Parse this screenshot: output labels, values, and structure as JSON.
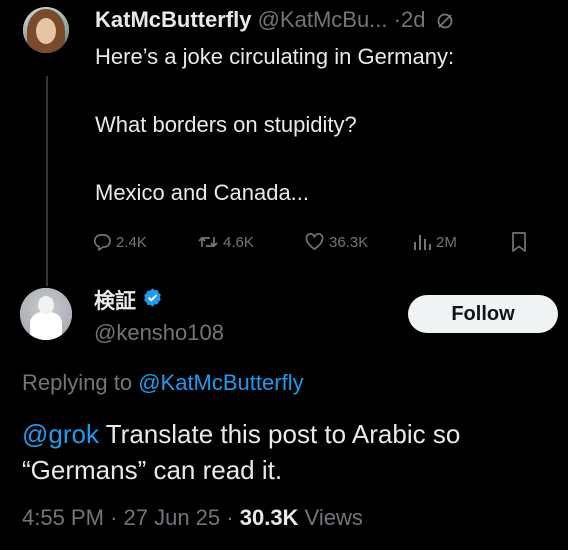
{
  "parent_tweet": {
    "author_name": "KatMcButterfly",
    "author_handle": "@KatMcBu...",
    "separator": "·",
    "time": "2d",
    "text": "Here’s a joke circulating in Germany:\n\nWhat borders on stupidity?\n\nMexico and Canada...",
    "replies": "2.4K",
    "reposts": "4.6K",
    "likes": "36.3K",
    "views": "2M"
  },
  "reply_tweet": {
    "author_name": "検証",
    "author_handle": "@kensho108",
    "follow_label": "Follow",
    "replying_prefix": "Replying to",
    "replying_to": "@KatMcButterfly",
    "mention": "@grok",
    "text": " Translate this post to Arabic so “Germans” can read it.",
    "time": "4:55 PM",
    "date": "27 Jun 25",
    "views_count": "30.3K",
    "views_label": "Views",
    "separator": "·"
  },
  "colors": {
    "background": "#000000",
    "text_primary": "#e7e9ea",
    "text_secondary": "#71767b",
    "accent": "#1d9bf0",
    "verified": "#1d9bf0",
    "follow_bg": "#eff3f4"
  },
  "icons": {
    "reply": "reply-icon",
    "repost": "repost-icon",
    "like": "heart-icon",
    "views": "views-icon",
    "bookmark": "bookmark-icon",
    "verified": "verified-badge-icon",
    "edited": "edited-icon"
  }
}
